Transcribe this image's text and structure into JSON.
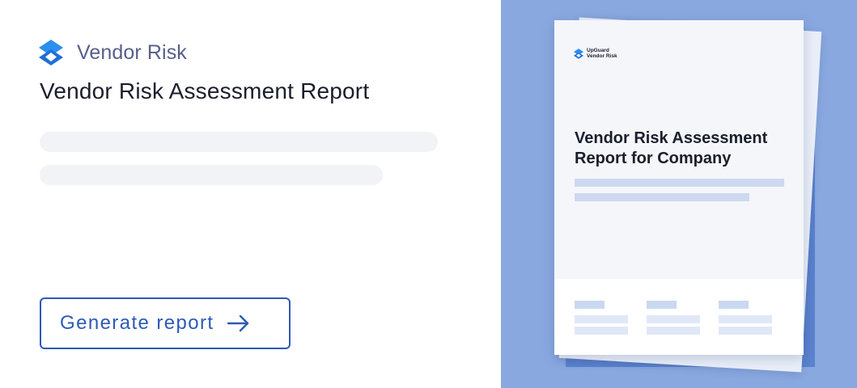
{
  "brand": {
    "name": "Vendor Risk",
    "logo_icon": "upguard-logo-icon",
    "accent": "#2b8ff0",
    "accent_dark": "#1f6fd6"
  },
  "main": {
    "title": "Vendor Risk Assessment Report",
    "generate_button": {
      "label": "Generate report",
      "icon": "arrow-right-icon",
      "color": "#2d5ab5"
    }
  },
  "preview": {
    "background": "#8aa8e0",
    "doc_brand_line1": "UpGuard",
    "doc_brand_line2": "Vendor Risk",
    "doc_title": "Vendor Risk Assessment Report for Company"
  }
}
